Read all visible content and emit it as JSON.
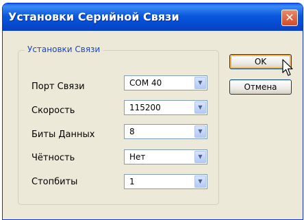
{
  "window": {
    "title": "Установки Серийной Связи"
  },
  "group": {
    "legend": "Установки Связи"
  },
  "fields": [
    {
      "label": "Порт Связи",
      "value": "COM 40"
    },
    {
      "label": "Скорость",
      "value": "115200"
    },
    {
      "label": "Биты Данных",
      "value": "8"
    },
    {
      "label": "Чётность",
      "value": "Нет"
    },
    {
      "label": "Стопбиты",
      "value": "1"
    }
  ],
  "buttons": {
    "ok": "OK",
    "cancel": "Отмена"
  },
  "icons": {
    "close": "close-icon",
    "dropdown": "chevron-down-icon",
    "cursor": "mouse-cursor-icon"
  },
  "colors": {
    "title_bar": "#0a58dc",
    "dialog_bg": "#ece9d8",
    "legend_text": "#1f44c2",
    "close_button": "#d34a27"
  }
}
